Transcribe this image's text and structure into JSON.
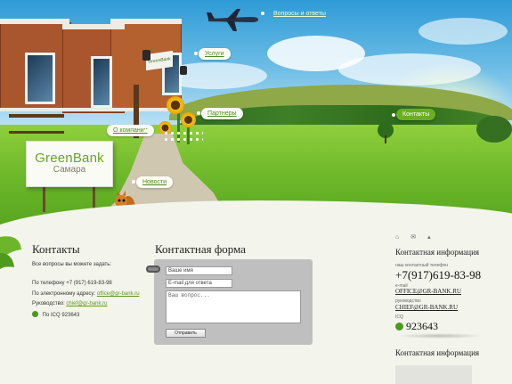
{
  "nav": {
    "faq": "Вопросы и ответы",
    "services": "Услуги",
    "partners": "Партнеры",
    "about": "О компании",
    "contacts": "Контакты",
    "news": "Новости"
  },
  "logo": {
    "name": "GreenBank",
    "city": "Самара",
    "building_sign": "GreenBank"
  },
  "contacts": {
    "title": "Контакты",
    "intro": "Все вопросы вы можете задать:",
    "phone_label": "По телефону",
    "phone": "+7 (917) 619-83-98",
    "email_label": "По электронному адресу:",
    "email": "office@gr-bank.ru",
    "director_label": "Руководство:",
    "director_email": "chief@gr-bank.ru",
    "icq_label": "По ICQ",
    "icq": "923643"
  },
  "form": {
    "title": "Контактная форма",
    "name_placeholder": "Ваше имя",
    "email_placeholder": "E-mail для ответа",
    "question_placeholder": "Ваш вопрос...",
    "submit": "Отправить"
  },
  "info": {
    "icons": [
      "home-icon",
      "mail-icon",
      "sitemap-icon"
    ],
    "title": "Контактная информация",
    "phone_label": "наш контактный телефон",
    "phone": "+7(917)619-83-98",
    "email_label": "e-mail",
    "email": "OFFICE@GR-BANK.RU",
    "director_label": "руководство",
    "director_email": "CHIEF@GR-BANK.RU",
    "icq_label": "ICQ",
    "icq": "923643",
    "title2": "Контактная информация"
  },
  "colors": {
    "accent": "#6aaf22",
    "link": "#5c9a1a",
    "form_bg": "#bfbfbf",
    "page_bg": "#f3f4ec"
  }
}
